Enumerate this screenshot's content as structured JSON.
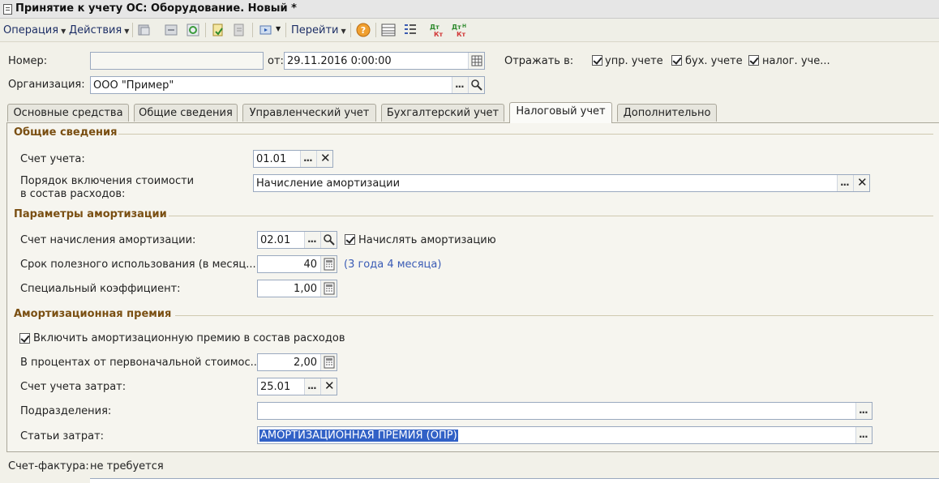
{
  "window": {
    "title": "Принятие к учету ОС: Оборудование. Новый *"
  },
  "toolbar": {
    "operation_label": "Операция",
    "actions_label": "Действия",
    "goto_label": "Перейти"
  },
  "header": {
    "number_label": "Номер:",
    "number_value": "",
    "date_label": "от:",
    "date_value": "29.11.2016  0:00:00",
    "reflect_label": "Отражать в:",
    "checks": [
      {
        "label": "упр. учете",
        "checked": true
      },
      {
        "label": "бух. учете",
        "checked": true
      },
      {
        "label": "налог. уче...",
        "checked": true
      }
    ],
    "org_label": "Организация:",
    "org_value": "ООО \"Пример\""
  },
  "tabs": [
    {
      "label": "Основные средства",
      "active": false
    },
    {
      "label": "Общие сведения",
      "active": false
    },
    {
      "label": "Управленческий учет",
      "active": false
    },
    {
      "label": "Бухгалтерский учет",
      "active": false
    },
    {
      "label": "Налоговый учет",
      "active": true
    },
    {
      "label": "Дополнительно",
      "active": false
    }
  ],
  "general": {
    "title": "Общие сведения",
    "account_label": "Счет учета:",
    "account_value": "01.01",
    "order_label_1": "Порядок включения стоимости",
    "order_label_2": "в состав расходов:",
    "order_value": "Начисление амортизации"
  },
  "depreciation": {
    "title": "Параметры амортизации",
    "account_label": "Счет начисления амортизации:",
    "account_value": "02.01",
    "accrue_label": "Начислять амортизацию",
    "accrue_checked": true,
    "term_label": "Срок полезного использования (в месяц...",
    "term_value": "40",
    "term_hint": "(3 года 4 месяца)",
    "coef_label": "Специальный коэффициент:",
    "coef_value": "1,00"
  },
  "premium": {
    "title": "Амортизационная премия",
    "include_label": "Включить амортизационную премию в состав расходов",
    "include_checked": true,
    "percent_label": "В процентах от первоначальной стоимос...",
    "percent_value": "2,00",
    "cost_account_label": "Счет учета затрат:",
    "cost_account_value": "25.01",
    "division_label": "Подразделения:",
    "division_value": "",
    "cost_item_label": "Статьи затрат:",
    "cost_item_value": "АМОРТИЗАЦИОННАЯ ПРЕМИЯ (ОПР)"
  },
  "footer": {
    "invoice_label": "Счет-фактура:",
    "invoice_value": "не требуется"
  },
  "colors": {
    "section_title": "#7a4f12",
    "hint": "#3a5bb5",
    "selection": "#3161c6"
  }
}
